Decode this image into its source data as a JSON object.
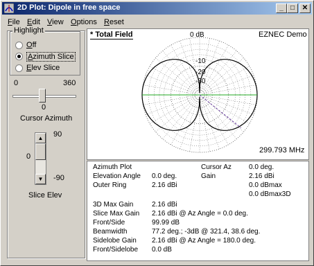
{
  "window": {
    "title": "2D Plot: Dipole in free space"
  },
  "titlebar_buttons": {
    "minimize": "_",
    "maximize": "□",
    "close": "✕"
  },
  "menu": [
    {
      "pre": "",
      "u": "F",
      "post": "ile"
    },
    {
      "pre": "",
      "u": "E",
      "post": "dit"
    },
    {
      "pre": "",
      "u": "V",
      "post": "iew"
    },
    {
      "pre": "",
      "u": "O",
      "post": "ptions"
    },
    {
      "pre": "",
      "u": "R",
      "post": "eset"
    }
  ],
  "highlight": {
    "group_title": "Highlight",
    "options": [
      {
        "u": "O",
        "rest": "ff",
        "selected": false
      },
      {
        "u": "A",
        "rest": "zimuth Slice",
        "selected": true
      },
      {
        "u": "E",
        "rest": "lev Slice",
        "selected": false
      }
    ]
  },
  "cursor_azimuth": {
    "min": "0",
    "max": "360",
    "value": "0",
    "label": "Cursor Azimuth",
    "fraction": 0.0
  },
  "slice_elev": {
    "max": "90",
    "min": "-90",
    "value": "0",
    "label": "Slice Elev"
  },
  "plot": {
    "title": "* Total Field",
    "brand": "EZNEC Demo",
    "ring_labels": [
      "0 dB",
      "-10",
      "-20",
      "-30"
    ],
    "frequency": "299.793 MHz"
  },
  "readout": {
    "rows": [
      {
        "label": "Azimuth Plot",
        "value": ""
      },
      {
        "label": "Elevation Angle",
        "value": "0.0 deg."
      },
      {
        "label": "Outer Ring",
        "value": "2.16 dBi"
      },
      {
        "label": "3D Max Gain",
        "value": "2.16 dBi"
      },
      {
        "label": "Slice Max Gain",
        "value": "2.16 dBi @ Az Angle = 0.0 deg."
      },
      {
        "label": "Front/Side",
        "value": "99.99 dB"
      },
      {
        "label": "Beamwidth",
        "value": "77.2 deg.; -3dB @ 321.4, 38.6 deg."
      },
      {
        "label": "Sidelobe Gain",
        "value": "2.16 dBi @ Az Angle = 180.0 deg."
      },
      {
        "label": "Front/Sidelobe",
        "value": "0.0 dB"
      }
    ],
    "cursor": [
      {
        "label": "Cursor Az",
        "value": "0.0 deg."
      },
      {
        "label": "Gain",
        "value": "2.16 dBi"
      },
      {
        "label": "",
        "value": "0.0 dBmax"
      },
      {
        "label": "",
        "value": "0.0 dBmax3D"
      }
    ]
  },
  "colors": {
    "cursor_line": "#22aa22",
    "slice_line": "#6a3fa0",
    "pattern": "#000000",
    "grid": "#555555"
  }
}
